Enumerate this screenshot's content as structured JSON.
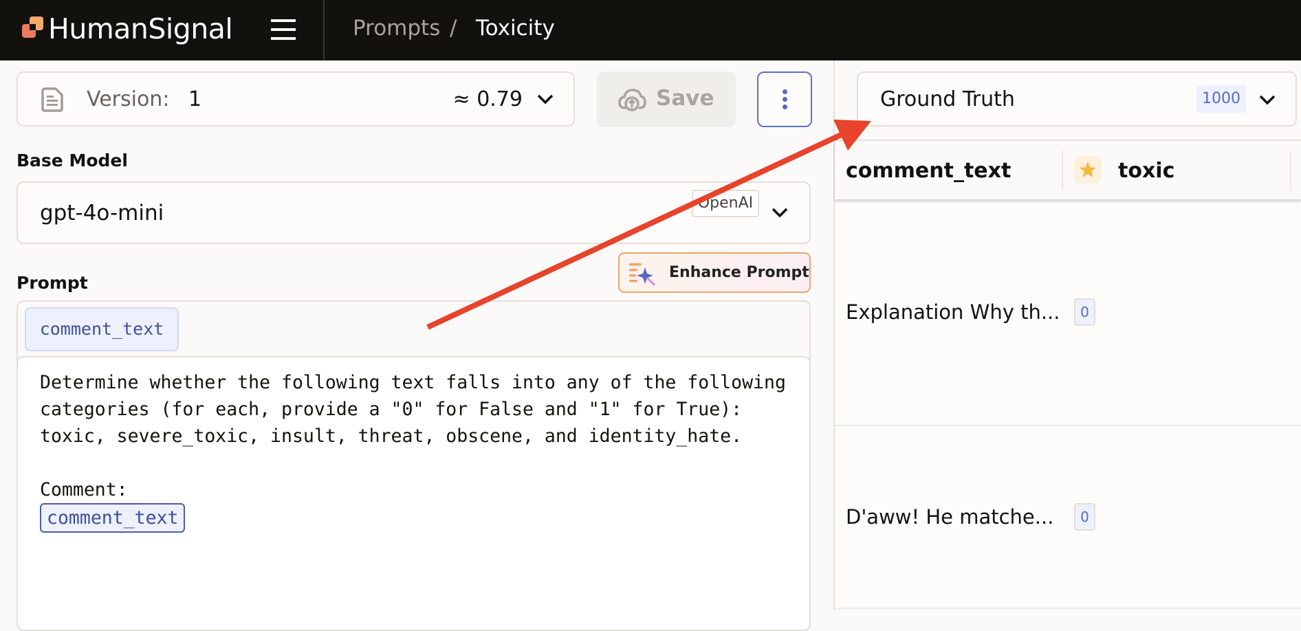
{
  "header": {
    "brand": "HumanSignal",
    "breadcrumb": {
      "parent": "Prompts",
      "separator": "/",
      "current": "Toxicity"
    },
    "icons": {
      "logo": "humansignal-logo",
      "menu": "hamburger-icon"
    }
  },
  "version_selector": {
    "label": "Version:",
    "value": "1",
    "score": "≈ 0.79",
    "icon": "document-icon"
  },
  "toolbar": {
    "save_label": "Save",
    "save_icon": "cloud-upload-icon",
    "more_icon": "vertical-ellipsis-icon"
  },
  "base_model": {
    "label": "Base Model",
    "value": "gpt-4o-mini",
    "provider": "OpenAI"
  },
  "prompt": {
    "label": "Prompt",
    "enhance_label": "Enhance Prompt",
    "variables": [
      "comment_text"
    ],
    "text_before": "Determine whether the following text falls into any of the following categories (for each, provide a \"0\" for False and \"1\" for True): toxic, severe_toxic, insult, threat, obscene, and identity_hate.\n\nComment:\n",
    "inline_variable": "comment_text"
  },
  "dataset": {
    "selector_label": "Ground Truth",
    "count": "1000",
    "columns": [
      "comment_text",
      "toxic"
    ],
    "rows": [
      {
        "comment_text": "Explanation Why th...",
        "toxic": "0"
      },
      {
        "comment_text": "D'aww! He matche...",
        "toxic": "0"
      }
    ]
  },
  "annotation": {
    "type": "arrow",
    "color": "#E8432B"
  },
  "colors": {
    "header_bg": "#12110D",
    "accent": "#5469C2",
    "star": "#F5B73F",
    "enhance_border": "#F0A468"
  }
}
